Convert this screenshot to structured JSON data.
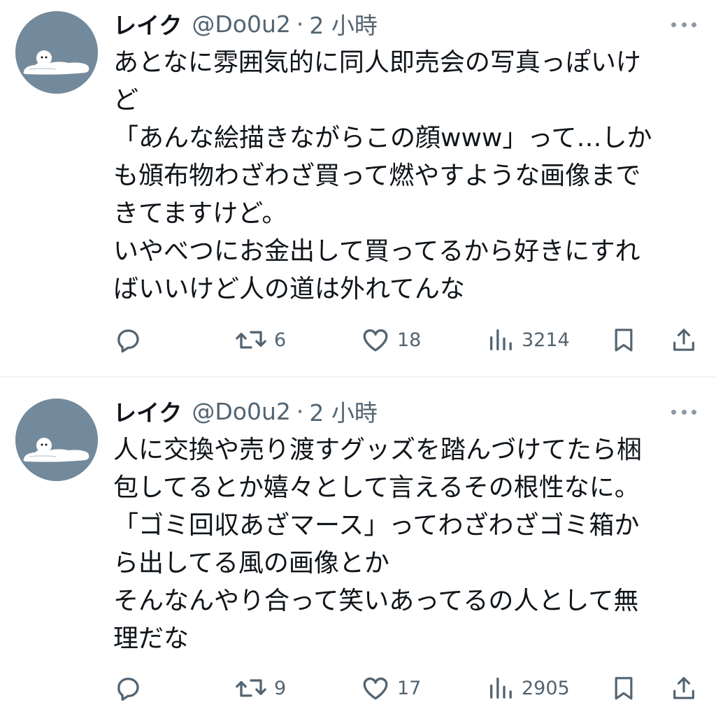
{
  "tweets": [
    {
      "author_name": "レイク",
      "handle": "@Do0u2",
      "separator": "·",
      "time": "2 小時",
      "lines": [
        "あとなに雰囲気的に同人即売会の写真っぽいけ",
        "ど",
        "「あんな絵描きながらこの顔www」って…しか",
        "も頒布物わざわざ買って燃やすような画像まで",
        "きてますけど。",
        "いやべつにお金出して買ってるから好きにすれ",
        "ばいいけど人の道は外れてんな"
      ],
      "retweets": "6",
      "likes": "18",
      "views": "3214"
    },
    {
      "author_name": "レイク",
      "handle": "@Do0u2",
      "separator": "·",
      "time": "2 小時",
      "lines": [
        "人に交換や売り渡すグッズを踏んづけてたら梱",
        "包してるとか嬉々として言えるその根性なに。",
        "「ゴミ回収あざマース」ってわざわざゴミ箱か",
        "ら出してる風の画像とか",
        "そんなんやり合って笑いあってるの人として無",
        "理だな"
      ],
      "retweets": "9",
      "likes": "17",
      "views": "2905"
    }
  ],
  "icons": {
    "avatar": "lying-blob-avatar",
    "more": "more-dots-icon",
    "reply": "reply-bubble-icon",
    "retweet": "retweet-icon",
    "like": "heart-icon",
    "views": "views-bar-icon",
    "bookmark": "bookmark-icon",
    "share": "share-icon"
  },
  "colors": {
    "text": "#0f1419",
    "secondary": "#536471",
    "avatar_bg": "#738a9c",
    "divider": "#eff3f4"
  }
}
